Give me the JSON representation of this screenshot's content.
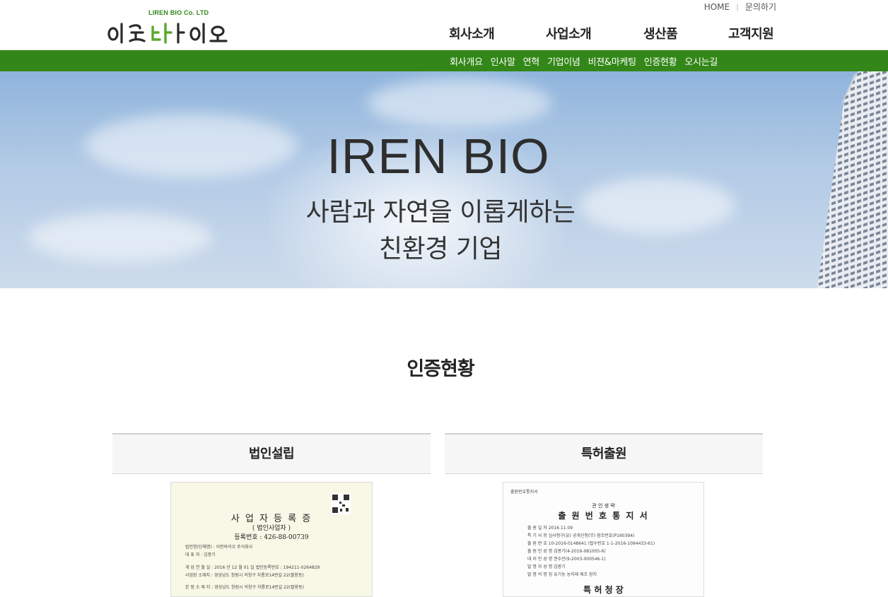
{
  "header": {
    "logo_alt": "이런바이오",
    "logo_sub": "LIREN BIO Co. LTD",
    "util_links": [
      "HOME",
      "문의하기"
    ],
    "main_nav": [
      "회사소개",
      "사업소개",
      "생산품",
      "고객지원"
    ],
    "sub_nav": [
      "회사개요",
      "인사말",
      "연혁",
      "기업이념",
      "비젼&마케팅",
      "인증현황",
      "오시는길"
    ]
  },
  "hero": {
    "title": "IREN BIO",
    "tagline_1": "사람과 자연을 이롭게하는",
    "tagline_2": "친환경 기업"
  },
  "section": {
    "title": "인증현황"
  },
  "certificates": [
    {
      "heading": "법인설립",
      "doc_title": "사 업 자 등 록 증",
      "doc_subtitle": "( 법인사업자 )",
      "reg_no": "등록번호 : 426-88-00739",
      "lines": [
        "법인명(단체명) : 이런바이오 주식회사",
        "대          표          자 : 김봉기",
        "개 업 연 월 일 : 2016 년 12 월 01 일      법인등록번호 : 194211-0264829",
        "사업장 소재지 : 경상남도 창원시 의창구 차룡로14번길 22(팔용동)",
        "본 점 소 재 지 : 경상남도 창원시 의창구 차룡로14번길 22(팔용동)"
      ]
    },
    {
      "heading": "특허출원",
      "doc_header": "출원번호통지서",
      "doc_caption": "관 인 생 략",
      "doc_title": "출 원 번 호 통 지 서",
      "lines": [
        "출  원  일  자   2016.11.09",
        "특  기  사  항   심사청구(유) 공개신청(무) 참조번호(P160394)",
        "출  원  번  호   10-2016-0148641 (접수번호 1-1-2016-1094433-61)",
        "출 원 인 성 명   김봉기(4-2016-081005-6)",
        "대 리 인 성 명   권수진(9-2003-000546-1)",
        "발 명 자 성 명   김봉기",
        "발 명 의 명 칭   유기농 농자재 제조 장치"
      ],
      "footer": "특    허    청    장"
    }
  ],
  "colors": {
    "green_bar": "#338718",
    "text": "#222222",
    "hero_sky": "#9dbde0"
  }
}
